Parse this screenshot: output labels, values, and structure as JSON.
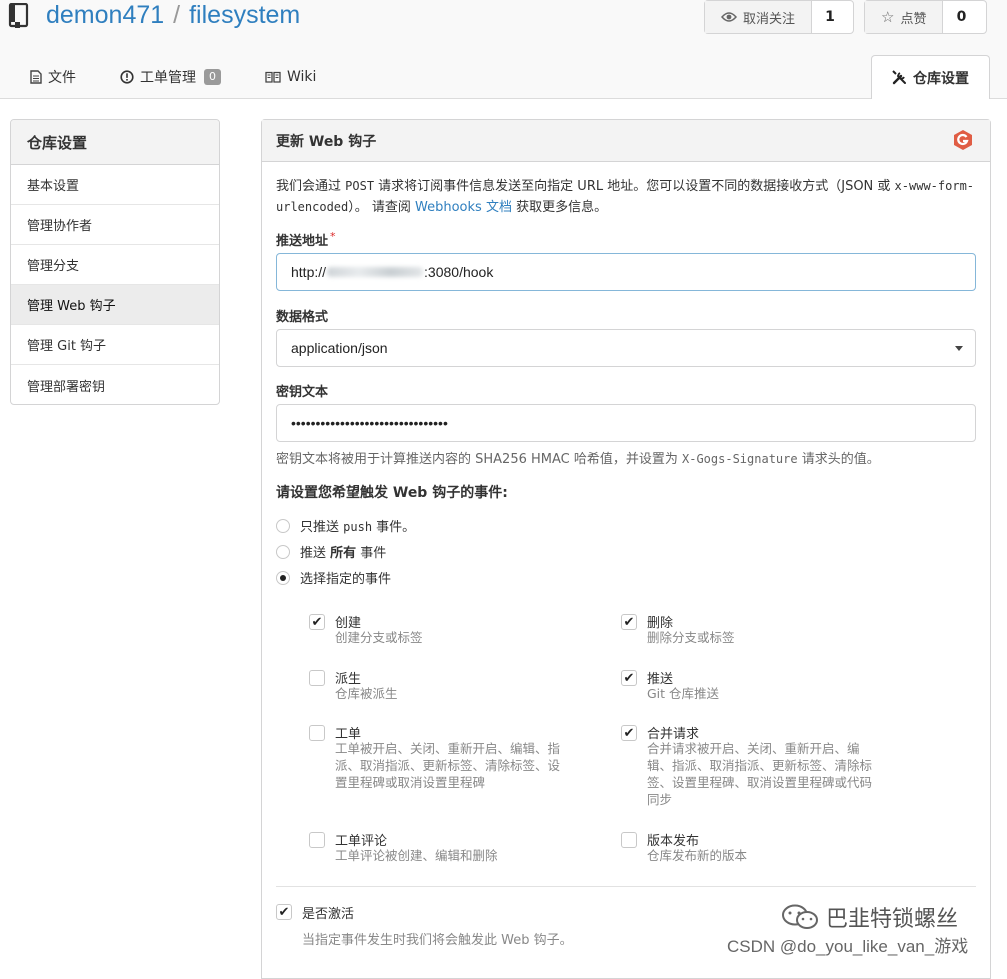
{
  "header": {
    "owner": "demon471",
    "separator": "/",
    "repo": "filesystem",
    "watch": {
      "label": "取消关注",
      "count": "1"
    },
    "star": {
      "label": "点赞",
      "count": "0"
    }
  },
  "tabs": {
    "files": "文件",
    "issues": "工单管理",
    "issues_count": "0",
    "wiki": "Wiki",
    "settings": "仓库设置"
  },
  "menu": {
    "title": "仓库设置",
    "items": [
      "基本设置",
      "管理协作者",
      "管理分支",
      "管理 Web 钩子",
      "管理 Git 钩子",
      "管理部署密钥"
    ]
  },
  "panel": {
    "title": "更新 Web 钩子",
    "desc": {
      "p1": "我们会通过 ",
      "post": "POST",
      "p2": " 请求将订阅事件信息发送至向指定 URL 地址。您可以设置不同的数据接收方式（JSON 或 ",
      "form": "x-www-form-urlencoded",
      "p3": "）。 请查阅 ",
      "link": "Webhooks 文档",
      "p4": " 获取更多信息。"
    },
    "url": {
      "label": "推送地址",
      "required": "*",
      "value_prefix": "http://",
      "value_suffix": ":3080/hook"
    },
    "content_type": {
      "label": "数据格式",
      "value": "application/json"
    },
    "secret": {
      "label": "密钥文本",
      "value": "••••••••••••••••••••••••••••••••",
      "hint_prefix": "密钥文本将被用于计算推送内容的 SHA256 HMAC 哈希值，并设置为 ",
      "hint_code": "X-Gogs-Signature",
      "hint_suffix": " 请求头的值。"
    },
    "events": {
      "label": "请设置您希望触发 Web 钩子的事件:",
      "radio_push_prefix": "只推送 ",
      "radio_push_code": "push",
      "radio_push_suffix": " 事件。",
      "radio_all_prefix": "推送 ",
      "radio_all_bold": "所有",
      "radio_all_suffix": " 事件",
      "radio_choose": "选择指定的事件",
      "items": [
        {
          "title": "创建",
          "desc": "创建分支或标签",
          "checked": true
        },
        {
          "title": "删除",
          "desc": "删除分支或标签",
          "checked": true
        },
        {
          "title": "派生",
          "desc": "仓库被派生",
          "checked": false
        },
        {
          "title": "推送",
          "desc": "Git 仓库推送",
          "checked": true
        },
        {
          "title": "工单",
          "desc": "工单被开启、关闭、重新开启、编辑、指派、取消指派、更新标签、清除标签、设置里程碑或取消设置里程碑",
          "checked": false
        },
        {
          "title": "合并请求",
          "desc": "合并请求被开启、关闭、重新开启、编辑、指派、取消指派、更新标签、清除标签、设置里程碑、取消设置里程碑或代码同步",
          "checked": true
        },
        {
          "title": "工单评论",
          "desc": "工单评论被创建、编辑和删除",
          "checked": false
        },
        {
          "title": "版本发布",
          "desc": "仓库发布新的版本",
          "checked": false
        }
      ]
    },
    "active": {
      "label": "是否激活",
      "desc": "当指定事件发生时我们将会触发此 Web 钩子。",
      "checked": true
    }
  },
  "watermark": {
    "wechat": "巴韭特锁螺丝",
    "csdn": "CSDN @do_you_like_van_游戏"
  },
  "colors": {
    "link": "#2f7fbf",
    "required": "#db2828",
    "gogs": "#e05d44"
  }
}
